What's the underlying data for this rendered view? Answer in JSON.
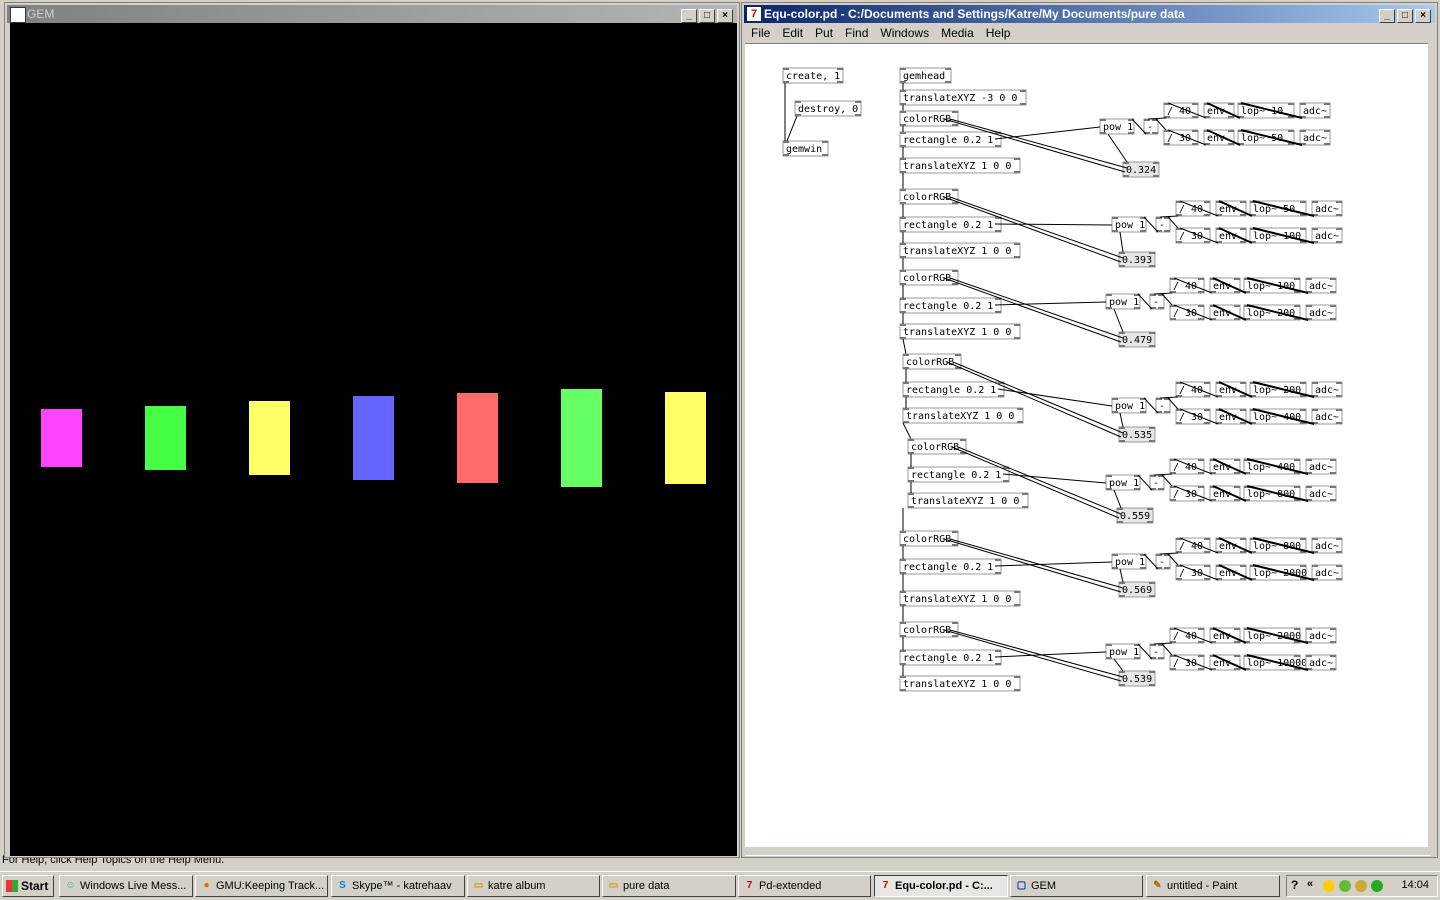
{
  "desktop": {
    "help_text": "For Help, click Help Topics on the Help Menu."
  },
  "gem_window": {
    "title": "GEM",
    "colors": [
      "#ff44ff",
      "#44ff44",
      "#ffff66",
      "#6666ff",
      "#ff6b6b",
      "#66ff66",
      "#ffff66"
    ]
  },
  "pd_window": {
    "title": "Equ-color.pd  - C:/Documents and Settings/Katre/My Documents/pure data",
    "menu": [
      "File",
      "Edit",
      "Put",
      "Find",
      "Windows",
      "Media",
      "Help"
    ],
    "objects": {
      "create": "create, 1",
      "destroy": "destroy, 0",
      "gemwin": "gemwin",
      "gemhead": "gemhead",
      "translate_first": "translateXYZ -3 0 0",
      "colorRGB": "colorRGB",
      "rectangle": "rectangle 0.2 1",
      "translate": "translateXYZ 1 0 0",
      "pow": "pow 1",
      "minus": "-",
      "div40": "/ 40",
      "div30": "/ 30",
      "env": "env",
      "adc": "adc~"
    },
    "bands": [
      {
        "number": "0.324",
        "lop_a": "lop~ 10",
        "lop_b": "lop~ 50"
      },
      {
        "number": "0.393",
        "lop_a": "lop~ 50",
        "lop_b": "lop~ 100"
      },
      {
        "number": "0.479",
        "lop_a": "lop~ 100",
        "lop_b": "lop~ 200"
      },
      {
        "number": "0.535",
        "lop_a": "lop~ 200",
        "lop_b": "lop~ 400"
      },
      {
        "number": "0.559",
        "lop_a": "lop~ 400",
        "lop_b": "lop~ 800"
      },
      {
        "number": "0.569",
        "lop_a": "lop~ 800",
        "lop_b": "lop~ 2000"
      },
      {
        "number": "0.539",
        "lop_a": "lop~ 2000",
        "lop_b": "lop~ 10000"
      }
    ]
  },
  "taskbar": {
    "start_label": "Start",
    "tasks": [
      "Windows Live Mess...",
      "GMU:Keeping Track...",
      "Skype™ - katrehaav",
      "katre album",
      "pure data",
      "Pd-extended",
      "Equ-color.pd - C:...",
      "GEM",
      "untitled - Paint"
    ],
    "clock": "14:04"
  }
}
